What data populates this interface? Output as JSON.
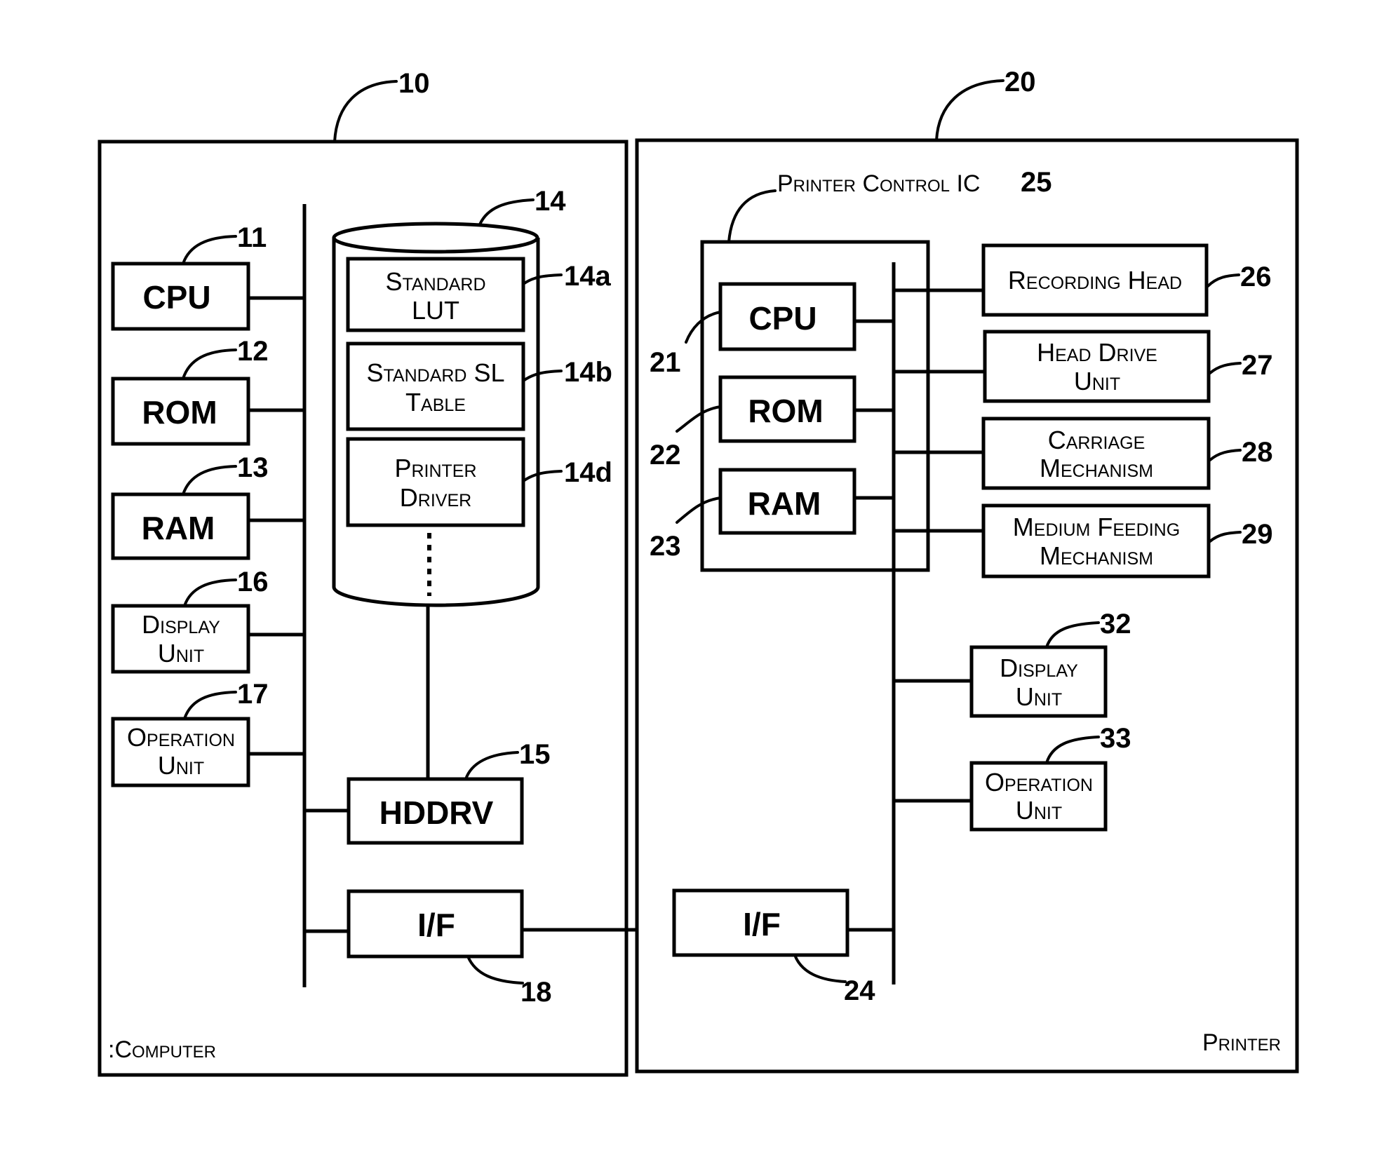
{
  "computer": {
    "ref": "10",
    "label": ":Computer",
    "blocks": [
      {
        "id": "cpu",
        "label": "CPU",
        "ref": "11"
      },
      {
        "id": "rom",
        "label": "ROM",
        "ref": "12"
      },
      {
        "id": "ram",
        "label": "RAM",
        "ref": "13"
      },
      {
        "id": "display",
        "label_line1": "Display",
        "label_line2": "Unit",
        "ref": "16"
      },
      {
        "id": "operation",
        "label_line1": "Operation",
        "label_line2": "Unit",
        "ref": "17"
      }
    ],
    "storage": {
      "ref": "14",
      "items": [
        {
          "line1": "Standard",
          "line2": "LUT",
          "ref": "14a"
        },
        {
          "line1": "Standard SL",
          "line2": "Table",
          "ref": "14b"
        },
        {
          "line1": "Printer",
          "line2": "Driver",
          "ref": "14d"
        }
      ]
    },
    "hddrv": {
      "label": "HDDRV",
      "ref": "15"
    },
    "interface": {
      "label": "I/F",
      "ref": "18"
    }
  },
  "printer": {
    "ref": "20",
    "label": "Printer",
    "control_ic": {
      "label": "Printer Control IC",
      "ref": "25",
      "blocks": [
        {
          "label": "CPU",
          "ref": "21"
        },
        {
          "label": "ROM",
          "ref": "22"
        },
        {
          "label": "RAM",
          "ref": "23"
        }
      ]
    },
    "units": [
      {
        "line1": "Recording Head",
        "line2": "",
        "ref": "26"
      },
      {
        "line1": "Head Drive",
        "line2": "Unit",
        "ref": "27"
      },
      {
        "line1": "Carriage",
        "line2": "Mechanism",
        "ref": "28"
      },
      {
        "line1": "Medium Feeding",
        "line2": "Mechanism",
        "ref": "29"
      }
    ],
    "display": {
      "line1": "Display",
      "line2": "Unit",
      "ref": "32"
    },
    "operation": {
      "line1": "Operation",
      "line2": "Unit",
      "ref": "33"
    },
    "interface": {
      "label": "I/F",
      "ref": "24"
    }
  }
}
